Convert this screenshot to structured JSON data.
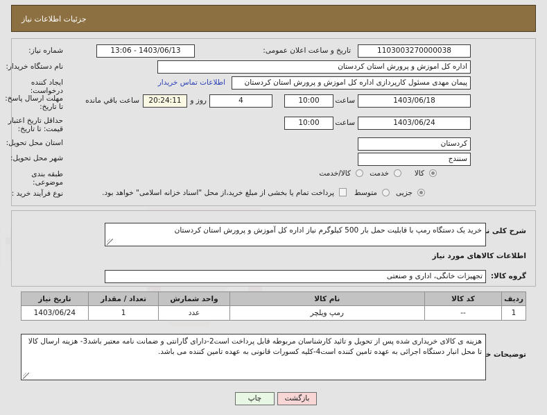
{
  "header": {
    "title": "جزئیات اطلاعات نیاز"
  },
  "form": {
    "need_number_label": "شماره نیاز:",
    "need_number_value": "1103003270000038",
    "announce_datetime_label": "تاریخ و ساعت اعلان عمومی:",
    "announce_datetime_value": "1403/06/13 - 13:06",
    "buyer_org_label": "نام دستگاه خریدار:",
    "buyer_org_value": "اداره کل اموزش و پرورش استان کردستان",
    "requester_label": "ایجاد کننده درخواست:",
    "requester_value": "پیمان مهدی مسئول کارپردازی اداره کل اموزش و پرورش استان کردستان",
    "contact_link": "اطلاعات تماس خریدار",
    "response_deadline_label": "مهلت ارسال پاسخ: تا تاریخ:",
    "response_deadline_date": "1403/06/18",
    "hour_label": "ساعت",
    "response_deadline_time": "10:00",
    "days_remaining": "4",
    "days_label": "روز و",
    "time_remaining": "20:24:11",
    "remaining_suffix": "ساعت باقي مانده",
    "price_validity_label": "حداقل تاریخ اعتبار قیمت: تا تاریخ:",
    "price_validity_date": "1403/06/24",
    "price_validity_hour_label": "ساعت",
    "price_validity_time": "10:00",
    "province_label": "استان محل تحویل:",
    "province_value": "کردستان",
    "city_label": "شهر محل تحویل:",
    "city_value": "سنندج",
    "classification_label": "طبقه بندی موضوعی:",
    "classification_options": [
      "کالا",
      "خدمت",
      "کالا/خدمت"
    ],
    "classification_selected": "کالا",
    "process_type_label": "نوع فرآیند خرید :",
    "process_type_options": [
      "جزیی",
      "متوسط"
    ],
    "process_type_selected": "جزیی",
    "treasury_checkbox_label": "پرداخت تمام یا بخشی از مبلغ خرید،از محل \"اسناد خزانه اسلامی\" خواهد بود.",
    "treasury_checked": false
  },
  "description": {
    "label": "شرح کلی نیاز:",
    "value": "خرید یک دستگاه رمپ با قابلیت حمل بار 500 کیلوگرم نیاز اداره کل آموزش و پرورش استان کردستان"
  },
  "goods_section": {
    "heading": "اطلاعات کالاهای مورد نیاز",
    "group_label": "گروه کالا:",
    "group_value": "تجهیزات خانگی، اداری و صنعتی"
  },
  "table": {
    "columns": [
      "ردیف",
      "کد کالا",
      "نام کالا",
      "واحد شمارش",
      "تعداد / مقدار",
      "تاریخ نیاز"
    ],
    "rows": [
      {
        "row": "1",
        "code": "--",
        "name": "رمپ ویلچر",
        "unit": "عدد",
        "qty": "1",
        "need_date": "1403/06/24"
      }
    ]
  },
  "buyer_notes": {
    "label": "توضیحات خریدار:",
    "value": "هزینه ی کالای خریداری شده پس از تحویل و تائید کارشناسان مربوطه قابل پرداخت است2-دارای گارانتی و ضمانت نامه معتبر باشد3- هزینه ارسال کالا تا محل انبار دستگاه اجرائی به عهده تامین کننده است4-کلیه کسورات قانونی به عهده تامین کننده می باشد."
  },
  "footer": {
    "print_label": "چاپ",
    "back_label": "بازگشت"
  },
  "colors": {
    "header_bg": "#8d7041",
    "link": "#2a3fb8",
    "print_btn": "#e8f6e4",
    "back_btn": "#f8d6d6",
    "highlight_field": "#fbf8e3"
  }
}
